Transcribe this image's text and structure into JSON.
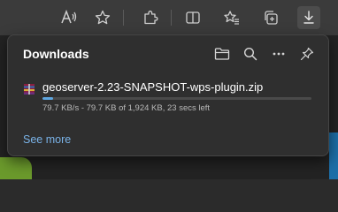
{
  "toolbar": {
    "icons": [
      "read-aloud-icon",
      "favorite-star-icon",
      "extensions-icon",
      "split-screen-icon",
      "favorites-icon",
      "collections-icon",
      "downloads-icon"
    ]
  },
  "downloads_panel": {
    "title": "Downloads",
    "actions": [
      "open-folder-icon",
      "search-icon",
      "more-options-icon",
      "pin-icon"
    ],
    "item": {
      "file_name": "geoserver-2.23-SNAPSHOT-wps-plugin.zip",
      "status": "79.7 KB/s - 79.7 KB of 1,924 KB, 23 secs left",
      "progress_percent": 4.1,
      "file_icon": "zip-archive-icon"
    },
    "see_more_label": "See more"
  },
  "colors": {
    "accent": "#5ea6e0",
    "link": "#7ab3e8",
    "panel_bg": "#2f2f2f",
    "toolbar_bg": "#3b3b3b"
  }
}
